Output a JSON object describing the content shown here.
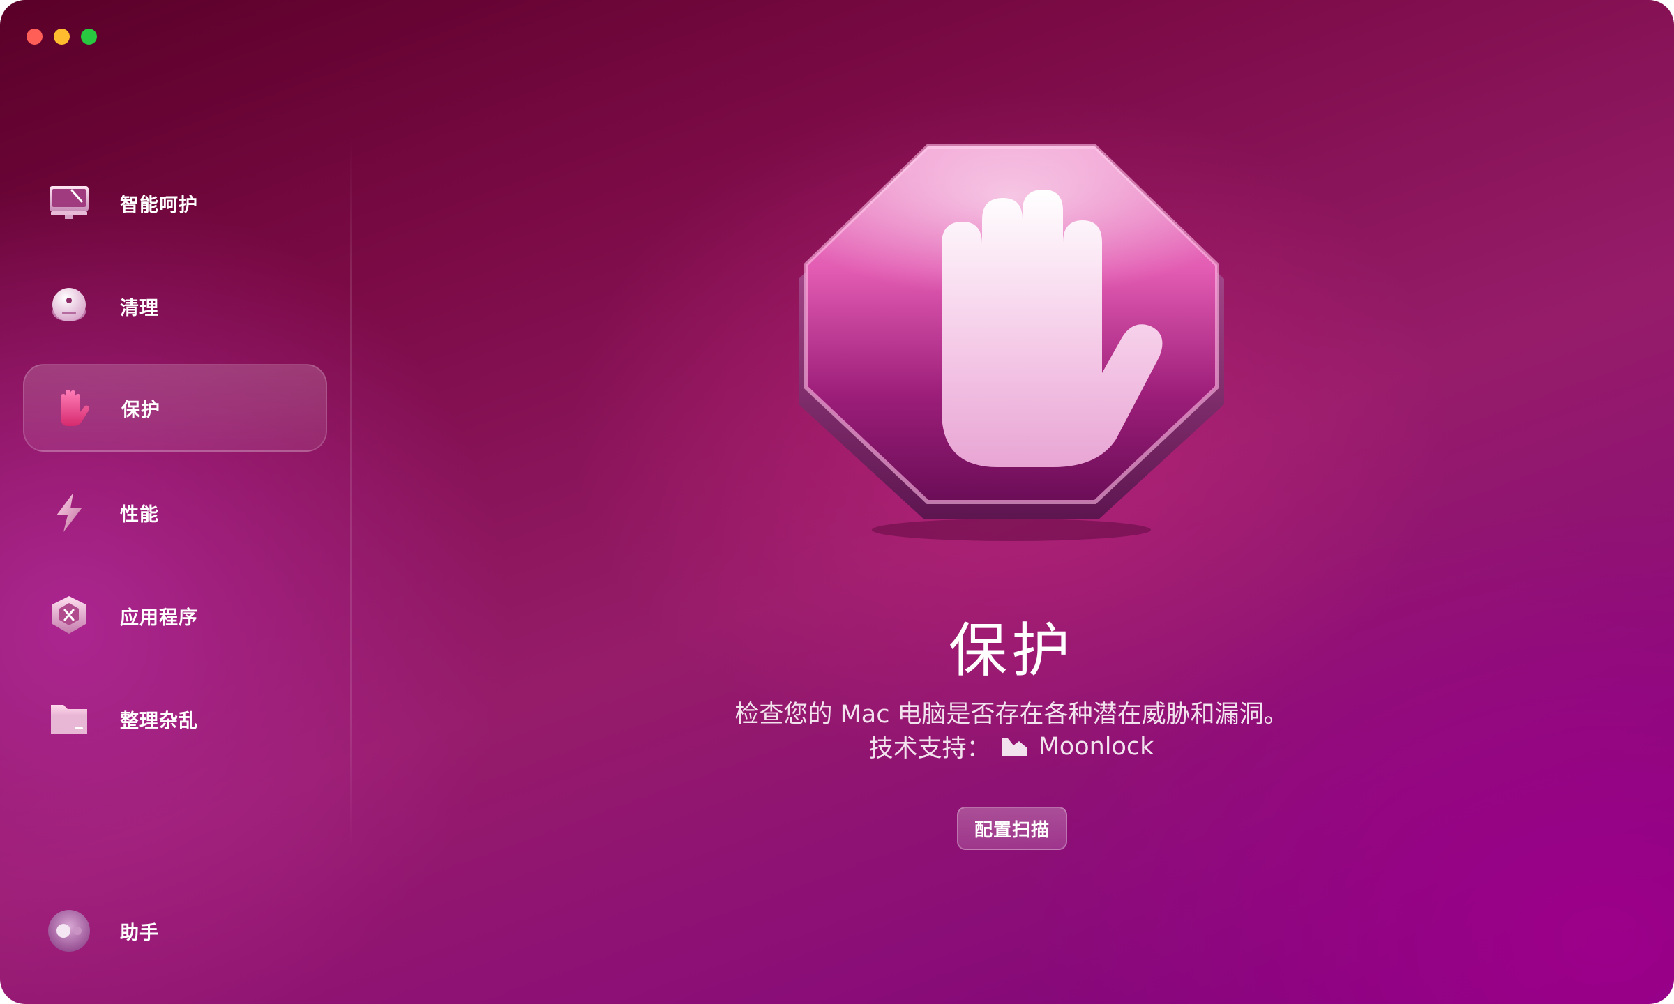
{
  "window": {
    "controls": [
      "close",
      "minimize",
      "zoom"
    ]
  },
  "sidebar": {
    "items": [
      {
        "label": "智能呵护",
        "icon": "monitor-icon"
      },
      {
        "label": "清理",
        "icon": "cleanup-disc-icon"
      },
      {
        "label": "保护",
        "icon": "hand-icon",
        "active": true
      },
      {
        "label": "性能",
        "icon": "lightning-icon"
      },
      {
        "label": "应用程序",
        "icon": "applications-icon"
      },
      {
        "label": "整理杂乱",
        "icon": "folder-icon"
      }
    ],
    "assistant": {
      "label": "助手",
      "icon": "assistant-toggle-icon"
    }
  },
  "main": {
    "hero_icon": "stop-hand-octagon-icon",
    "title": "保护",
    "description": "检查您的 Mac 电脑是否存在各种潜在威胁和漏洞。",
    "powered_by_label": "技术支持：",
    "powered_by_brand": "Moonlock",
    "powered_by_icon": "moonlock-logo-icon",
    "button_label": "配置扫描"
  },
  "colors": {
    "accent": "#8b0a6e",
    "hero_pink": "#e45fb3",
    "traffic_red": "#ff5f57",
    "traffic_yellow": "#febc2e",
    "traffic_green": "#28c840"
  }
}
